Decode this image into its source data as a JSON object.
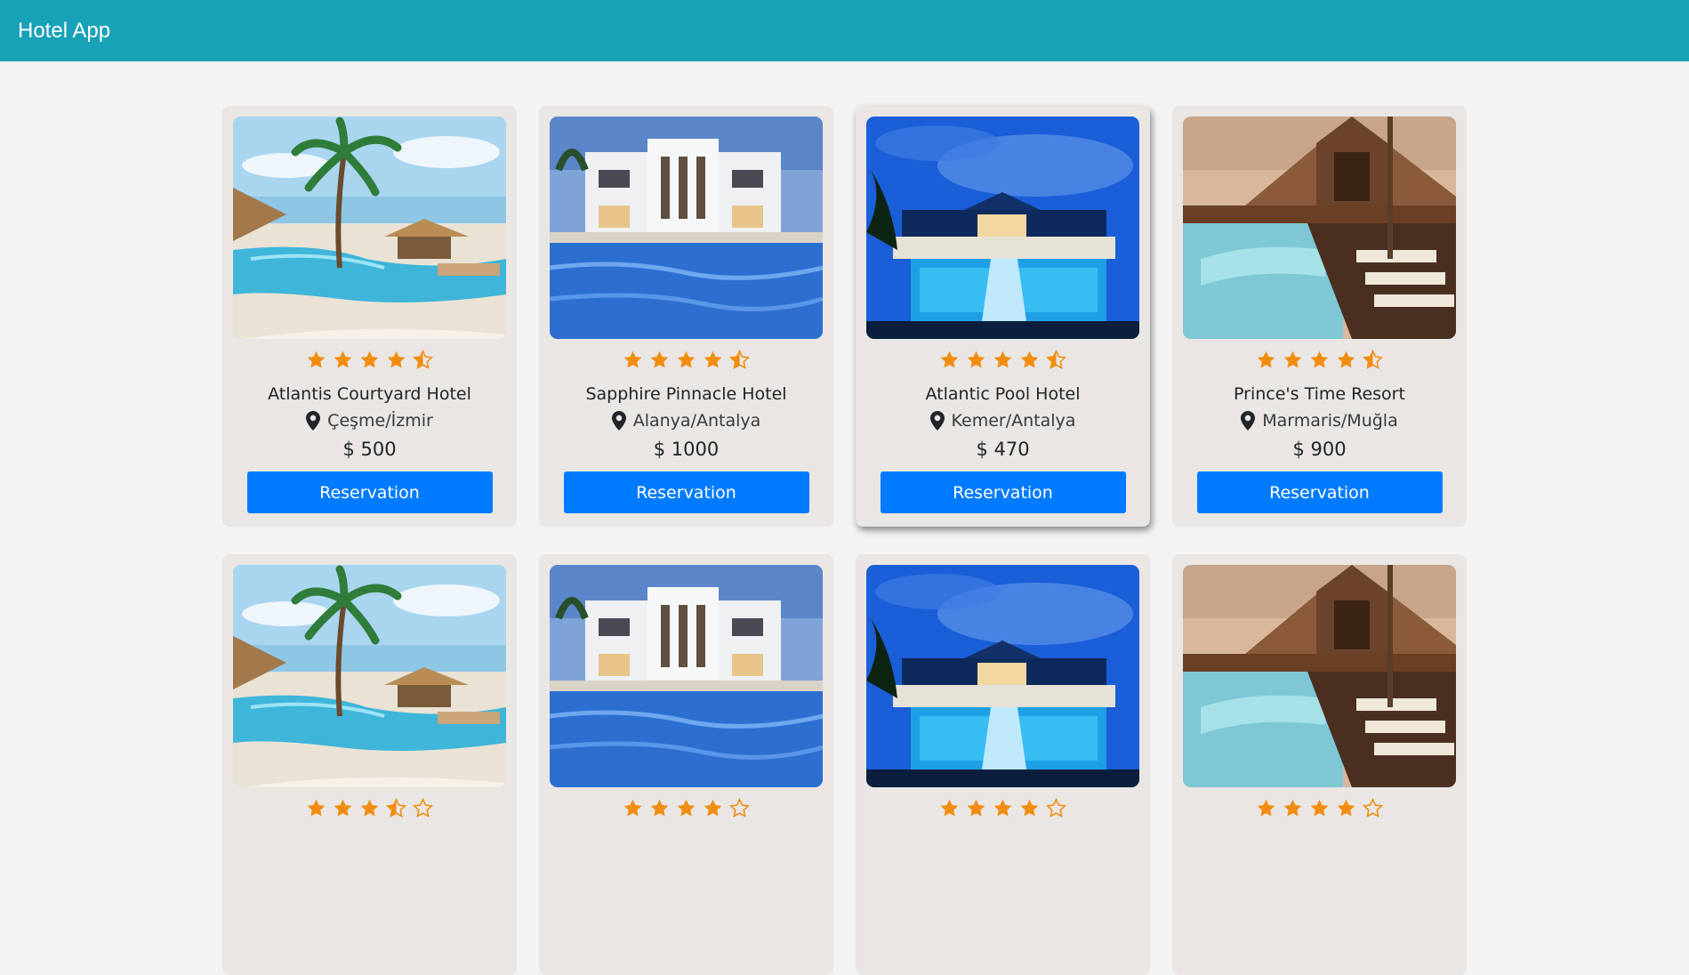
{
  "app": {
    "title": "Hotel App"
  },
  "colors": {
    "header": "#17a2b8",
    "star": "#f28c0f",
    "button": "#007bff",
    "card": "#e9e6e3"
  },
  "hotels": [
    {
      "name": "Atlantis Courtyard Hotel",
      "location": "Çeşme/İzmir",
      "price": "$ 500",
      "rating": 4.5,
      "button": "Reservation",
      "photo": "tropical-pool-palms"
    },
    {
      "name": "Sapphire Pinnacle Hotel",
      "location": "Alanya/Antalya",
      "price": "$ 1000",
      "rating": 4.5,
      "button": "Reservation",
      "photo": "white-building-pool"
    },
    {
      "name": "Atlantic Pool Hotel",
      "location": "Kemer/Antalya",
      "price": "$ 470",
      "rating": 4.5,
      "button": "Reservation",
      "photo": "night-pool"
    },
    {
      "name": "Prince's Time Resort",
      "location": "Marmaris/Muğla",
      "price": "$ 900",
      "rating": 4.5,
      "button": "Reservation",
      "photo": "wooden-lodge-pool"
    },
    {
      "rating": 3.5,
      "photo": "tropical-pool-palms"
    },
    {
      "rating": 4,
      "photo": "white-building-pool"
    },
    {
      "rating": 4,
      "photo": "night-pool"
    },
    {
      "rating": 4,
      "photo": "wooden-lodge-pool"
    }
  ]
}
